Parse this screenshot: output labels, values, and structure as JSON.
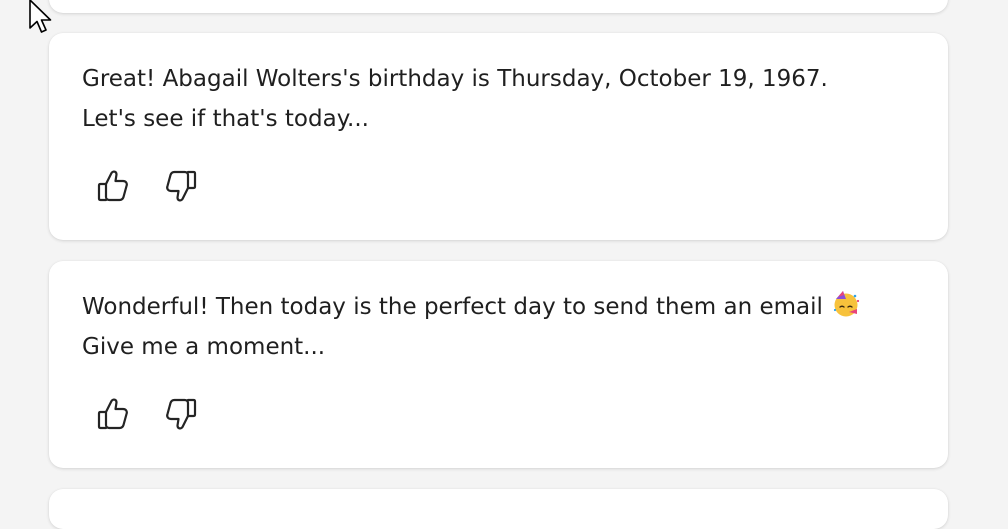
{
  "messages": [
    {
      "line1": "Great! Abagail Wolters's birthday is Thursday, October 19, 1967.",
      "line2": "Let's see if that's today...",
      "emoji": ""
    },
    {
      "line1": "Wonderful! Then today is the perfect day to send them an email",
      "line2": "Give me a moment...",
      "emoji": "partying-face-icon"
    }
  ],
  "icons": {
    "thumbs_up": "thumbs-up-icon",
    "thumbs_down": "thumbs-down-icon",
    "cursor": "mouse-pointer-icon"
  },
  "colors": {
    "background": "#f4f4f4",
    "card": "#ffffff",
    "text": "#1f1f1f",
    "icon_stroke": "#242424"
  }
}
